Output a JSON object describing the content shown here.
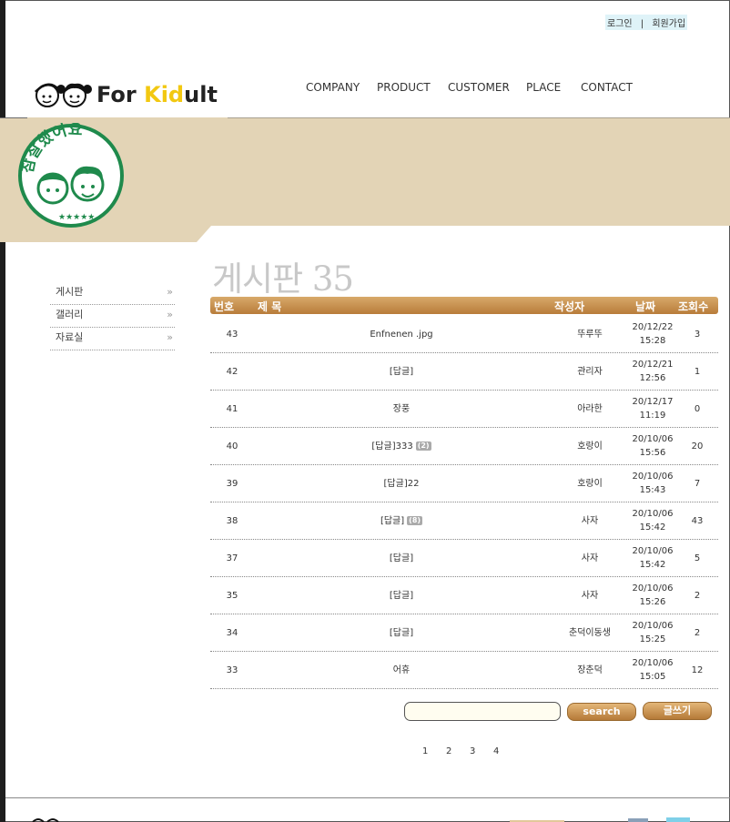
{
  "top_links": {
    "login": "로그인",
    "separator": "|",
    "join": "회원가입"
  },
  "logo": {
    "for": "For",
    "kid": "Kid",
    "ult": "ult"
  },
  "nav": [
    "COMPANY",
    "PRODUCT",
    "CUSTOMER",
    "PLACE",
    "CONTACT"
  ],
  "stamp": {
    "text": "참잘했어요"
  },
  "sidebar": {
    "items": [
      {
        "label": "게시판",
        "chev": "»"
      },
      {
        "label": "갤러리",
        "chev": "»"
      },
      {
        "label": "자료실",
        "chev": "»"
      }
    ]
  },
  "board": {
    "title": "게시판 35",
    "headers": {
      "num": "번호",
      "subject": "제 목",
      "author": "작성자",
      "date": "날짜",
      "views": "조회수"
    },
    "rows": [
      {
        "num": "43",
        "subject": "Enfnenen .jpg",
        "badge": "",
        "author": "뚜루뚜",
        "date1": "20/12/22",
        "date2": "15:28",
        "views": "3"
      },
      {
        "num": "42",
        "subject": "[답글]",
        "badge": "",
        "author": "관리자",
        "date1": "20/12/21",
        "date2": "12:56",
        "views": "1"
      },
      {
        "num": "41",
        "subject": "장풍",
        "badge": "",
        "author": "아라한",
        "date1": "20/12/17",
        "date2": "11:19",
        "views": "0"
      },
      {
        "num": "40",
        "subject": "[답글]333",
        "badge": "(2)",
        "author": "호랑이",
        "date1": "20/10/06",
        "date2": "15:56",
        "views": "20"
      },
      {
        "num": "39",
        "subject": "[답글]22",
        "badge": "",
        "author": "호랑이",
        "date1": "20/10/06",
        "date2": "15:43",
        "views": "7"
      },
      {
        "num": "38",
        "subject": "[답글]",
        "badge": "(8)",
        "author": "사자",
        "date1": "20/10/06",
        "date2": "15:42",
        "views": "43"
      },
      {
        "num": "37",
        "subject": "[답글]",
        "badge": "",
        "author": "사자",
        "date1": "20/10/06",
        "date2": "15:42",
        "views": "5"
      },
      {
        "num": "35",
        "subject": "[답글]",
        "badge": "",
        "author": "사자",
        "date1": "20/10/06",
        "date2": "15:26",
        "views": "2"
      },
      {
        "num": "34",
        "subject": "[답글]",
        "badge": "",
        "author": "춘덕이동생",
        "date1": "20/10/06",
        "date2": "15:25",
        "views": "2"
      },
      {
        "num": "33",
        "subject": "어휴",
        "badge": "",
        "author": "장춘덕",
        "date1": "20/10/06",
        "date2": "15:05",
        "views": "12"
      }
    ]
  },
  "search": {
    "value": "",
    "button": "search"
  },
  "write_button": "글쓰기",
  "pagination": [
    "1",
    "2",
    "3",
    "4"
  ],
  "colors": {
    "banner": "#e3d4b6",
    "header_bar": "#c8914f",
    "stamp": "#1f8a4c",
    "logo_accent": "#f2c811"
  }
}
